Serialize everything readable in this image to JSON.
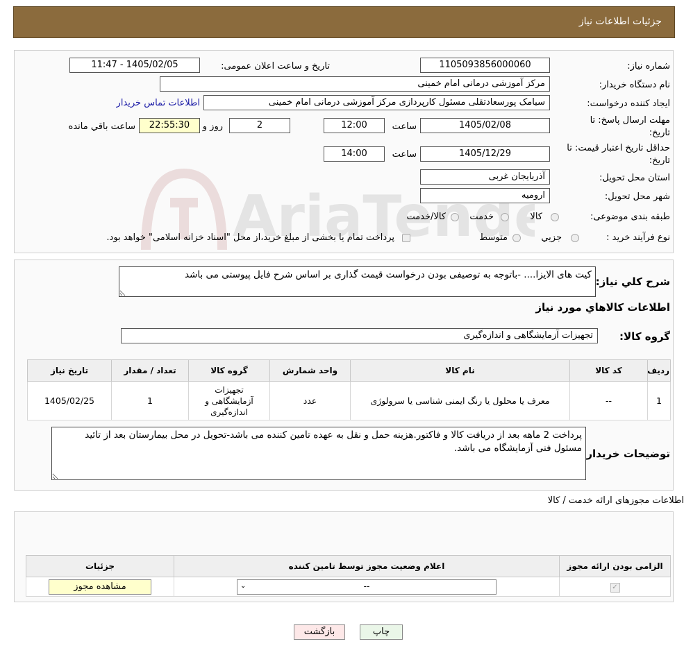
{
  "header": {
    "title": "جزئیات اطلاعات نیاز"
  },
  "watermark": {
    "text": "AriaTender.neT"
  },
  "info": {
    "need_number_label": "شماره نیاز:",
    "need_number": "1105093856000060",
    "announce_label": "تاریخ و ساعت اعلان عمومی:",
    "announce_value": "1405/02/05 - 11:47",
    "buyer_label": "نام دستگاه خریدار:",
    "buyer_value": "مرکز آموزشی درمانی امام خمینی",
    "creator_label": "ایجاد کننده درخواست:",
    "creator_value": "سیامک پورسعادتقلی مسئول کارپردازی مرکز آموزشی درمانی امام خمینی",
    "contact_link": "اطلاعات تماس خریدار",
    "deadline_label_1": "مهلت ارسال پاسخ: تا",
    "deadline_label_2": "تاریخ:",
    "deadline_date": "1405/02/08",
    "time_label": "ساعت",
    "deadline_time": "12:00",
    "days_value": "2",
    "day_word": "روز و",
    "remaining_time": "22:55:30",
    "remaining_label": "ساعت باقي مانده",
    "validity_label_1": "حداقل تاریخ اعتبار قیمت: تا",
    "validity_label_2": "تاریخ:",
    "validity_date": "1405/12/29",
    "validity_time": "14:00",
    "province_label": "استان محل تحویل:",
    "province_value": "آذربایجان غربی",
    "city_label": "شهر محل تحویل:",
    "city_value": "ارومیه",
    "category_label": "طبقه بندی موضوعی:",
    "category_options": [
      "کالا",
      "خدمت",
      "کالا/خدمت"
    ],
    "purchase_type_label": "نوع فرآیند خرید :",
    "purchase_options": [
      "جزیي",
      "متوسط"
    ],
    "purchase_note": "پرداخت تمام یا بخشی از مبلغ خرید،از محل \"اسناد خزانه اسلامی\" خواهد بود."
  },
  "general": {
    "desc_label": "شرح کلي نیاز:",
    "desc_value": "کیت های الایزا.... -باتوجه به توصیفی بودن درخواست قیمت گذاری بر اساس شرح فایل پیوستی می باشد",
    "goods_title": "اطلاعات کالاهاي مورد نیاز",
    "group_label": "گروه کالا:",
    "group_value": "تجهیزات آزمایشگاهی و اندازه‌گیری"
  },
  "goods_table": {
    "headers": [
      "ردیف",
      "کد کالا",
      "نام کالا",
      "واحد شمارش",
      "گروه کالا",
      "تعداد / مقدار",
      "تاریخ نیاز"
    ],
    "rows": [
      [
        "1",
        "--",
        "معرف یا محلول یا رنگ ایمنی شناسی یا سرولوژی",
        "عدد",
        "تجهیزات آزمایشگاهی و اندازه‌گیری",
        "1",
        "1405/02/25"
      ]
    ]
  },
  "buyer_notes": {
    "label": "توضیحات خریدار:",
    "value": "پرداخت 2 ماهه بعد از دریافت کالا و فاکتور.هزینه حمل و نقل به عهده تامین کننده می باشد-تحویل در محل بیمارستان بعد از تائید مسئول فنی آزمایشگاه می باشد."
  },
  "permits": {
    "title": "اطلاعات مجوزهای ارائه خدمت / کالا",
    "headers": [
      "الزامی بودن ارائه مجوز",
      "اعلام وضعیت مجوز توسط تامین کننده",
      "جزئیات"
    ],
    "select_value": "--",
    "view_button": "مشاهده مجوز"
  },
  "actions": {
    "print": "چاپ",
    "back": "بازگشت"
  },
  "colors": {
    "header_bg": "#8b6b3d",
    "panel_border": "#cfcfcf",
    "back_button_bg": "#fde8e8",
    "print_button_bg": "#eaf6e8"
  }
}
